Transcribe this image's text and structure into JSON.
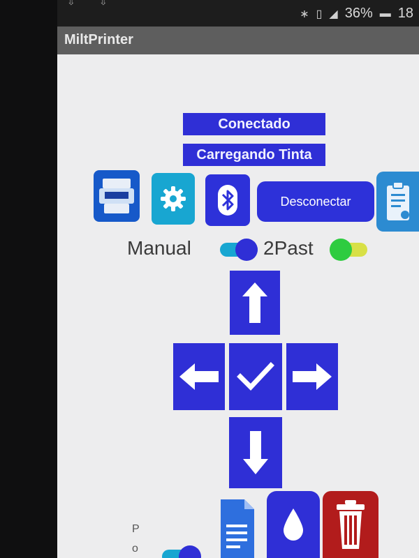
{
  "status_bar": {
    "battery": "36%",
    "time": "18"
  },
  "app": {
    "title": "MiltPrinter"
  },
  "labels": {
    "connection_status": "Conectado",
    "loading_status": "Carregando Tinta"
  },
  "toolbar": {
    "disconnect_label": "Desconectar",
    "logo_icon": "app-logo-icon",
    "settings_icon": "gear-icon",
    "bluetooth_icon": "bluetooth-icon",
    "clipboard_icon": "clipboard-icon"
  },
  "modes": {
    "manual_label": "Manual",
    "past_label": "2Past"
  },
  "bottom": {
    "side_letters": [
      "P",
      "o"
    ]
  },
  "colors": {
    "accent_blue": "#2f2fd6",
    "toggle_blue": "#18a6d1",
    "toggle_green": "#2ecc40",
    "toggle_yellow": "#d8e046",
    "trash_red": "#b21c1c"
  }
}
